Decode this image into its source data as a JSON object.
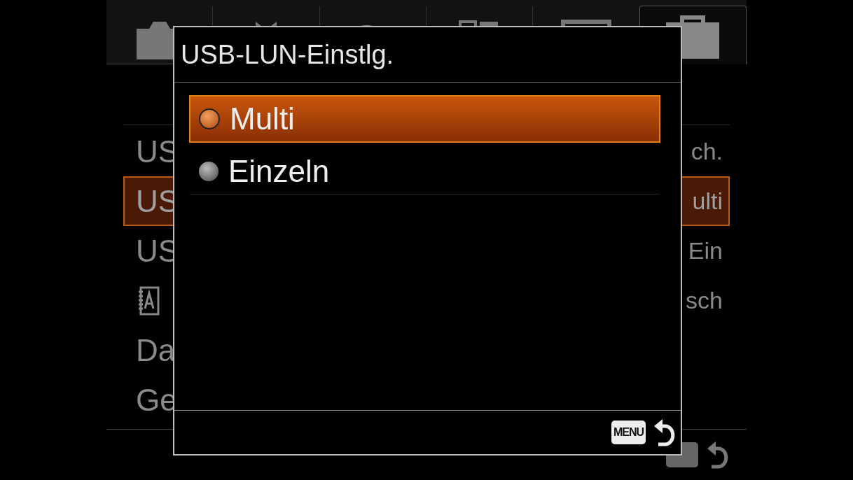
{
  "tabs": [
    {
      "kind": "camera",
      "selected": false
    },
    {
      "kind": "custom",
      "selected": false
    },
    {
      "kind": "wireless",
      "selected": false
    },
    {
      "kind": "apps",
      "selected": false
    },
    {
      "kind": "display",
      "selected": false
    },
    {
      "kind": "toolbox",
      "selected": true
    }
  ],
  "menu_rows": [
    {
      "kind": "text",
      "label": "US",
      "value": "ch.",
      "selected": false
    },
    {
      "kind": "text",
      "label": "US",
      "value": "ulti",
      "selected": true
    },
    {
      "kind": "text",
      "label": "US",
      "value": "Ein",
      "selected": false
    },
    {
      "kind": "icon",
      "value": "sch",
      "selected": false
    },
    {
      "kind": "text",
      "label": "Da",
      "selected": false
    },
    {
      "kind": "text",
      "label": "Ge",
      "selected": false
    }
  ],
  "dialog": {
    "title": "USB-LUN-Einstlg.",
    "options": [
      {
        "label": "Multi",
        "selected": true
      },
      {
        "label": "Einzeln",
        "selected": false
      }
    ],
    "menu_key": "MENU"
  }
}
